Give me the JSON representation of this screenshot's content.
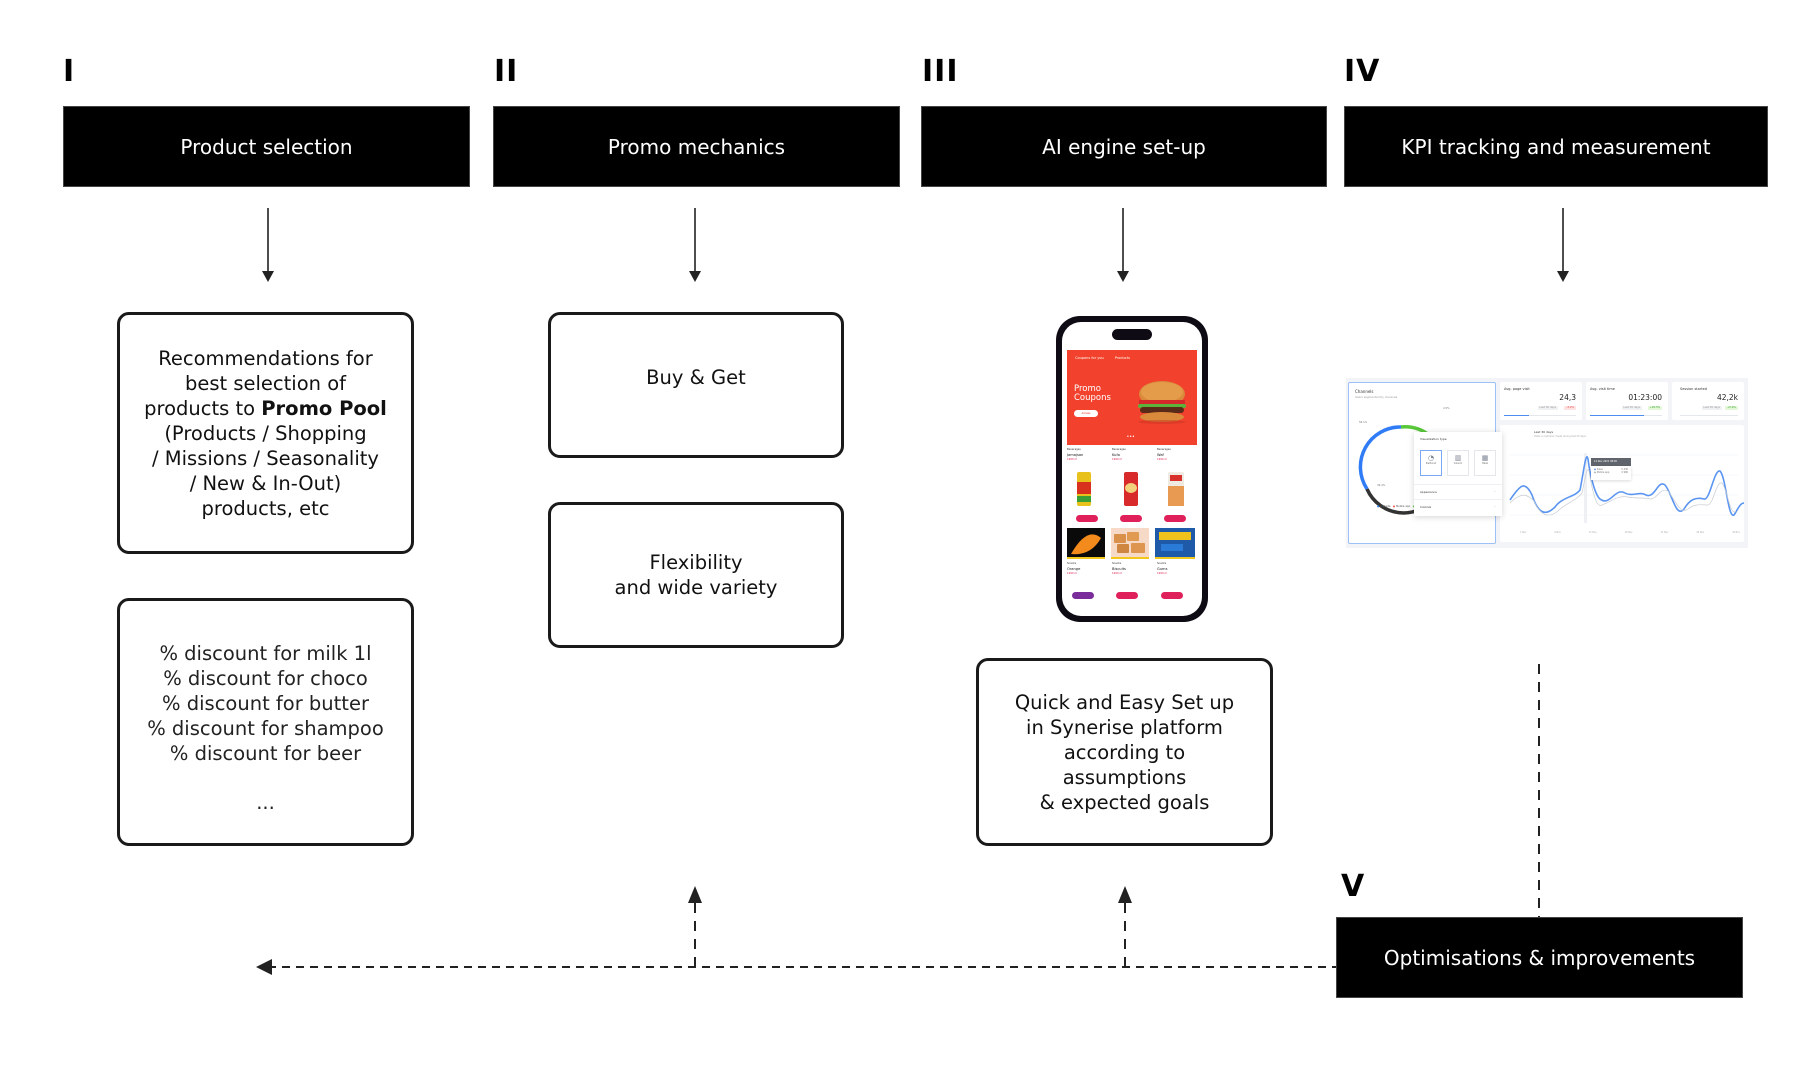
{
  "stages": [
    {
      "numeral": "I",
      "title": "Product selection"
    },
    {
      "numeral": "II",
      "title": "Promo mechanics"
    },
    {
      "numeral": "III",
      "title": "AI engine set-up"
    },
    {
      "numeral": "IV",
      "title": "KPI tracking and measurement"
    },
    {
      "numeral": "V",
      "title": "Optimisations & improvements"
    }
  ],
  "product_selection": {
    "recommendation_pre": "Recommendations for best selection of products to ",
    "recommendation_bold": "Promo Pool",
    "recommendation_post": " (Products / Shopping / Missions / Seasonality / New & In-Out) products, etc",
    "lines": [
      "Recommendations for",
      "best selection of",
      "products to"
    ],
    "lines_after": [
      "(Products / Shopping",
      "/ Missions / Seasonality",
      "/ New & In-Out)",
      "products, etc"
    ],
    "discounts": [
      "% discount for milk 1l",
      "% discount for choco",
      "% discount for butter",
      "% discount for shampoo",
      "% discount for beer"
    ],
    "ellipsis": "..."
  },
  "promo_mechanics": {
    "cards": [
      {
        "lines": [
          "Buy & Get"
        ]
      },
      {
        "lines": [
          "Flexibility",
          "and wide variety"
        ]
      }
    ]
  },
  "ai_engine": {
    "phone": {
      "tabs": [
        "Coupons for you",
        "Products"
      ],
      "hero_title": [
        "Promo",
        "Coupons"
      ],
      "hero_button": "Activate",
      "products": [
        {
          "category": "Beverages",
          "name": "Jamajsan",
          "price": "1990 zł"
        },
        {
          "category": "Beverages",
          "name": "Kufo",
          "price": "1990 zł"
        },
        {
          "category": "Beverages",
          "name": "Waf",
          "price": "1990 zł"
        },
        {
          "category": "Snacks",
          "name": "Orange",
          "price": "1990 zł"
        },
        {
          "category": "Snacks",
          "name": "Biscuits",
          "price": "1990 zł"
        },
        {
          "category": "Snacks",
          "name": "Gums",
          "price": "1990 zł"
        }
      ],
      "colors": {
        "hero": "#f2422e",
        "button": "#e0205a",
        "button_alt": "#7a2d9a"
      }
    },
    "description": [
      "Quick and Easy Set up",
      "in Synerise platform",
      "according to",
      "assumptions",
      "& expected goals"
    ]
  },
  "kpi_dashboard": {
    "channels": {
      "title": "Channels",
      "subtitle": "Users segmented by channels",
      "labels": [
        "56.1%",
        "4.5%",
        "39.4%"
      ],
      "legend": [
        "Website",
        "Mobile app",
        "Desktop"
      ],
      "legend_colors": [
        "#2f7cf6",
        "#f2594b",
        "#58c73a"
      ]
    },
    "popup": {
      "title": "Visualization type",
      "options": [
        "Pie/donut",
        "Column",
        "Table"
      ],
      "sections": [
        "Appearance",
        "Colorize"
      ]
    },
    "kpis": [
      {
        "label": "Avg. page visit",
        "value": "24,3",
        "period": "Last 30 days",
        "change": "-3,2%",
        "trend": "down",
        "progress": 0.35
      },
      {
        "label": "Avg. visit time",
        "value": "01:23:00",
        "period": "Last 30 days",
        "change": "+18,3%",
        "trend": "up",
        "progress": 0.75
      },
      {
        "label": "Session started",
        "value": "42,2k",
        "period": "Last 30 days",
        "change": "+5,6%",
        "trend": "up",
        "progress": 0.0
      }
    ],
    "line_chart": {
      "title": "Last 30 days",
      "subtitle": "Visits a customer made during last 30 days",
      "tooltip": {
        "date": "12 Nov 2021 08:00",
        "rows": [
          [
            "Sales",
            "5 430"
          ],
          [
            "Mobile app",
            "4 980"
          ]
        ]
      },
      "x_labels": [
        "1 Nov",
        "6 Nov",
        "11 Nov",
        "16 Nov",
        "21 Nov",
        "26 Nov",
        "30 Nov"
      ]
    }
  },
  "colors": {
    "header_bg": "#000000",
    "header_text": "#ffffff",
    "card_border": "#1a1a1a",
    "connector": "#222222"
  }
}
